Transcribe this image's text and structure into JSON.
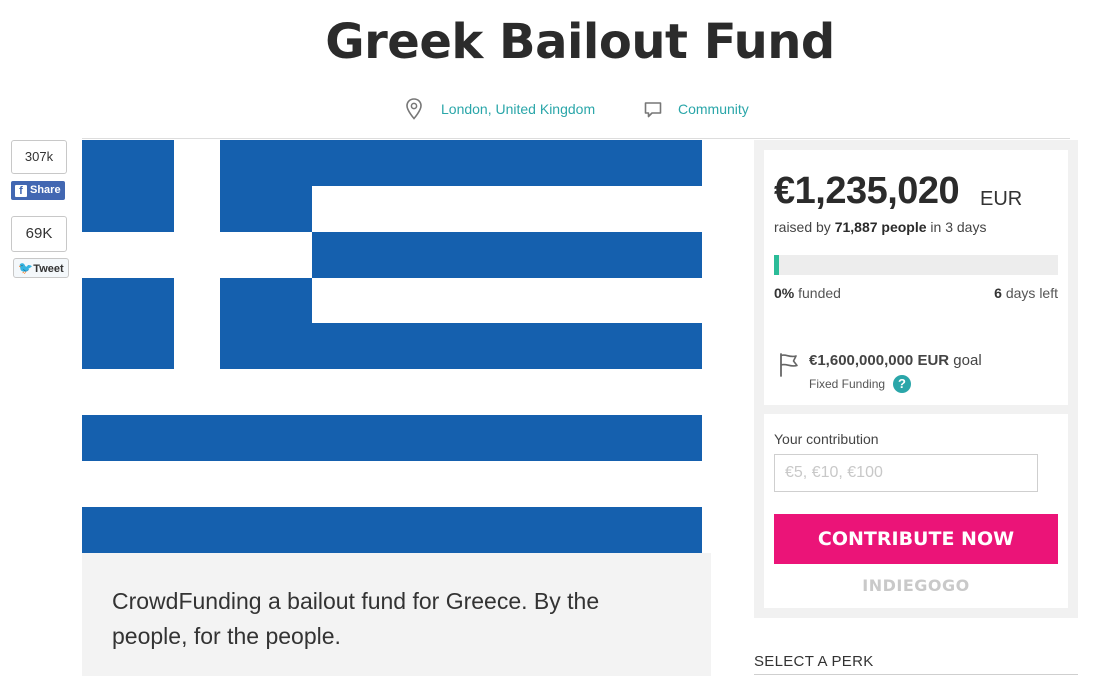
{
  "header": {
    "title": "Greek Bailout Fund",
    "location": "London, United Kingdom",
    "category": "Community",
    "link_color": "#2aa6a9"
  },
  "social": {
    "facebook_count": "307k",
    "facebook_label": "Share",
    "facebook_glyph": "f",
    "twitter_count": "69K",
    "twitter_label": "Tweet",
    "twitter_glyph": "🐦"
  },
  "description": "CrowdFunding a bailout fund for Greece. By the people, for the people.",
  "campaign": {
    "raised_amount": "€1,235,020",
    "raised_currency": "EUR",
    "raised_by_prefix": "raised by",
    "backers": "71,887 people",
    "raised_by_suffix": "in 3 days",
    "funded_percent": "0%",
    "funded_label": "funded",
    "days_left_number": "6",
    "days_left_label": "days left",
    "progress_fraction": 0.007,
    "progress_color": "#2bbc98",
    "goal_amount": "€1,600,000,000",
    "goal_currency": "EUR",
    "goal_label": "goal",
    "funding_type": "Fixed Funding",
    "help_glyph": "?"
  },
  "contribute": {
    "label": "Your contribution",
    "placeholder": "€5, €10, €100",
    "button_label": "CONTRIBUTE NOW",
    "button_color": "#eb1478",
    "brand": "INDIEGOGO"
  },
  "perks": {
    "heading": "SELECT A PERK"
  },
  "flag": {
    "blue": "#1560ae",
    "white": "#ffffff"
  }
}
